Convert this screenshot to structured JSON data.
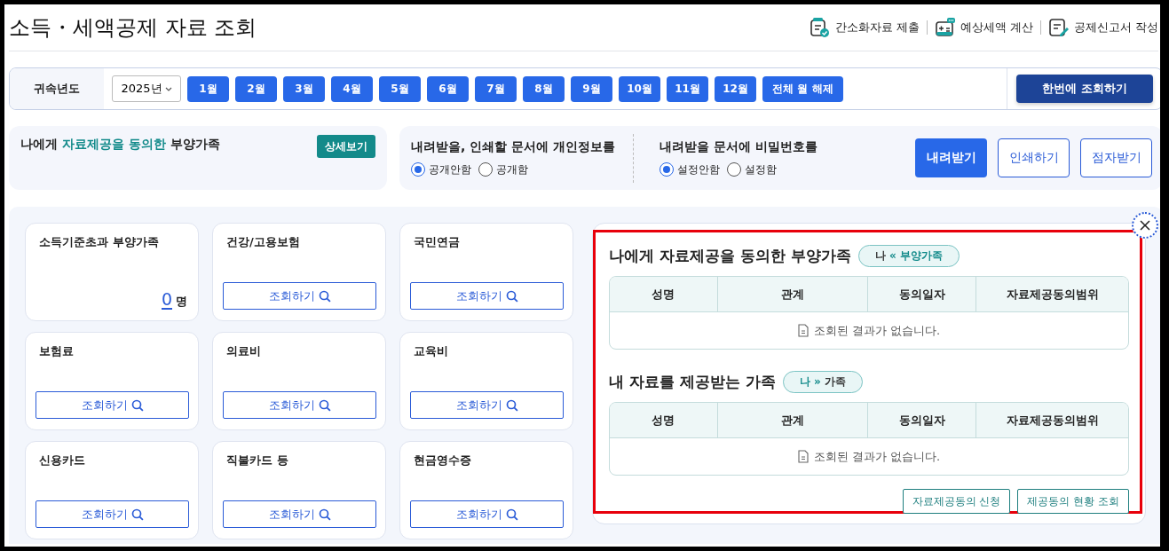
{
  "page_title": "소득・세액공제 자료 조회",
  "header_links": [
    {
      "label": "간소화자료 제출"
    },
    {
      "label": "예상세액 계산"
    },
    {
      "label": "공제신고서 작성"
    }
  ],
  "filter_bar": {
    "year_label": "귀속년도",
    "year_select": "2025년",
    "months": [
      {
        "label": "1월"
      },
      {
        "label": "2월"
      },
      {
        "label": "3월"
      },
      {
        "label": "4월"
      },
      {
        "label": "5월"
      },
      {
        "label": "6월"
      },
      {
        "label": "7월"
      },
      {
        "label": "8월"
      },
      {
        "label": "9월"
      },
      {
        "label": "10월"
      },
      {
        "label": "11월"
      },
      {
        "label": "12월"
      }
    ],
    "clear_button": "전체 월 해제",
    "query_all_button": "한번에 조회하기"
  },
  "consent_panel": {
    "title_before": "나에게 ",
    "title_highlight": "자료제공을 동의한",
    "title_after": " 부양가족",
    "detail_button": "상세보기"
  },
  "options_panel": {
    "groups": [
      {
        "title": "내려받을, 인쇄할 문서에 개인정보를",
        "options": [
          {
            "label": "공개안함",
            "selected": true
          },
          {
            "label": "공개함",
            "selected": false
          }
        ]
      },
      {
        "title": "내려받을 문서에 비밀번호를",
        "options": [
          {
            "label": "설정안함",
            "selected": true
          },
          {
            "label": "설정함",
            "selected": false
          }
        ]
      }
    ],
    "buttons": [
      {
        "label": "내려받기",
        "kind": "primary"
      },
      {
        "label": "인쇄하기",
        "kind": "outline"
      },
      {
        "label": "점자받기",
        "kind": "outline"
      }
    ]
  },
  "cards": [
    {
      "title": "소득기준초과 부양가족",
      "kind": "count",
      "count": "0",
      "unit": "명"
    },
    {
      "title": "건강/고용보험",
      "kind": "query",
      "button": "조회하기"
    },
    {
      "title": "국민연금",
      "kind": "query",
      "button": "조회하기"
    },
    {
      "title": "보험료",
      "kind": "query",
      "button": "조회하기"
    },
    {
      "title": "의료비",
      "kind": "query",
      "button": "조회하기"
    },
    {
      "title": "교육비",
      "kind": "query",
      "button": "조회하기"
    },
    {
      "title": "신용카드",
      "kind": "query",
      "button": "조회하기"
    },
    {
      "title": "직불카드 등",
      "kind": "query",
      "button": "조회하기"
    },
    {
      "title": "현금영수증",
      "kind": "query",
      "button": "조회하기"
    }
  ],
  "family_panel": {
    "highlighted": true,
    "sections": [
      {
        "title": "나에게 자료제공을 동의한 부양가족",
        "badge": {
          "from": "나",
          "arrow": "«",
          "to": "부양가족",
          "kind": "incoming"
        },
        "columns": [
          "성명",
          "관계",
          "동의일자",
          "자료제공동의범위"
        ],
        "empty_message": "조회된 결과가 없습니다."
      },
      {
        "title": "내 자료를 제공받는 가족",
        "badge": {
          "from": "나",
          "arrow": "»",
          "to": "가족",
          "kind": "outgoing"
        },
        "columns": [
          "성명",
          "관계",
          "동의일자",
          "자료제공동의범위"
        ],
        "empty_message": "조회된 결과가 없습니다."
      }
    ],
    "buttons": [
      {
        "label": "자료제공동의 신청"
      },
      {
        "label": "제공동의 현황 조회"
      }
    ]
  }
}
